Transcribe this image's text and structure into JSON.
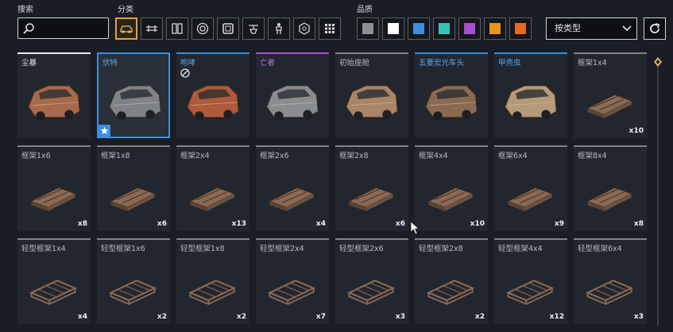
{
  "labels": {
    "search": "搜索",
    "category": "分类",
    "quality": "品质"
  },
  "search": {
    "value": "",
    "placeholder": ""
  },
  "categories": [
    {
      "icon": "car-body-icon"
    },
    {
      "icon": "chassis-icon"
    },
    {
      "icon": "fuel-tank-icon"
    },
    {
      "icon": "wheel-icon"
    },
    {
      "icon": "frame-icon"
    },
    {
      "icon": "turret-icon"
    },
    {
      "icon": "figure-icon"
    },
    {
      "icon": "cube-icon"
    },
    {
      "icon": "grid-icon"
    }
  ],
  "quality_colors": [
    "#8c8f94",
    "#ffffff",
    "#3a8fdc",
    "#3bc2b6",
    "#a54fd1",
    "#e8941e",
    "#e8681e"
  ],
  "sort": {
    "label": "按类型"
  },
  "items": [
    {
      "name": "尘暴",
      "quality": "white",
      "count": "",
      "tint": "#a86a4a",
      "shape": "body"
    },
    {
      "name": "伏特",
      "quality": "blue",
      "count": "",
      "tint": "#7f8387",
      "shape": "body",
      "selected": true,
      "star": true
    },
    {
      "name": "咆哮",
      "quality": "blue",
      "count": "",
      "tint": "#b05a3a",
      "shape": "body",
      "mod": true
    },
    {
      "name": "亡者",
      "quality": "purple",
      "count": "",
      "tint": "#8a8d90",
      "shape": "body"
    },
    {
      "name": "初始座舱",
      "quality": "gray",
      "count": "",
      "tint": "#a98466",
      "shape": "body"
    },
    {
      "name": "五菱宏光车头",
      "quality": "blue",
      "count": "",
      "tint": "#8a6a52",
      "shape": "body"
    },
    {
      "name": "甲壳虫",
      "quality": "blue",
      "count": "",
      "tint": "#b59a7a",
      "shape": "body"
    },
    {
      "name": "框架1x4",
      "quality": "gray",
      "count": "x10",
      "tint": "#8a6a55",
      "shape": "frame"
    },
    {
      "name": "框架1x6",
      "quality": "gray",
      "count": "x8",
      "tint": "#8a6a55",
      "shape": "frame"
    },
    {
      "name": "框架1x8",
      "quality": "gray",
      "count": "x6",
      "tint": "#8a6a55",
      "shape": "frame"
    },
    {
      "name": "框架2x4",
      "quality": "gray",
      "count": "x13",
      "tint": "#8a6a55",
      "shape": "frame"
    },
    {
      "name": "框架2x6",
      "quality": "gray",
      "count": "x4",
      "tint": "#8a6a55",
      "shape": "frame"
    },
    {
      "name": "框架2x8",
      "quality": "gray",
      "count": "x6",
      "tint": "#8a6a55",
      "shape": "frame"
    },
    {
      "name": "框架4x4",
      "quality": "gray",
      "count": "x10",
      "tint": "#8a6a55",
      "shape": "frame"
    },
    {
      "name": "框架6x4",
      "quality": "gray",
      "count": "x9",
      "tint": "#8a6a55",
      "shape": "frame"
    },
    {
      "name": "框架8x4",
      "quality": "gray",
      "count": "x8",
      "tint": "#8a6a55",
      "shape": "frame"
    },
    {
      "name": "轻型框架1x4",
      "quality": "gray",
      "count": "x4",
      "tint": "#8a6a55",
      "shape": "light"
    },
    {
      "name": "轻型框架1x6",
      "quality": "gray",
      "count": "x2",
      "tint": "#8a6a55",
      "shape": "light"
    },
    {
      "name": "轻型框架1x8",
      "quality": "gray",
      "count": "x2",
      "tint": "#8a6a55",
      "shape": "light"
    },
    {
      "name": "轻型框架2x4",
      "quality": "gray",
      "count": "x7",
      "tint": "#8a6a55",
      "shape": "light"
    },
    {
      "name": "轻型框架2x6",
      "quality": "gray",
      "count": "x3",
      "tint": "#8a6a55",
      "shape": "light"
    },
    {
      "name": "轻型框架2x8",
      "quality": "gray",
      "count": "x2",
      "tint": "#8a6a55",
      "shape": "light"
    },
    {
      "name": "轻型框架4x4",
      "quality": "gray",
      "count": "x12",
      "tint": "#8a6a55",
      "shape": "light"
    },
    {
      "name": "轻型框架6x4",
      "quality": "gray",
      "count": "x3",
      "tint": "#8a6a55",
      "shape": "light"
    }
  ]
}
